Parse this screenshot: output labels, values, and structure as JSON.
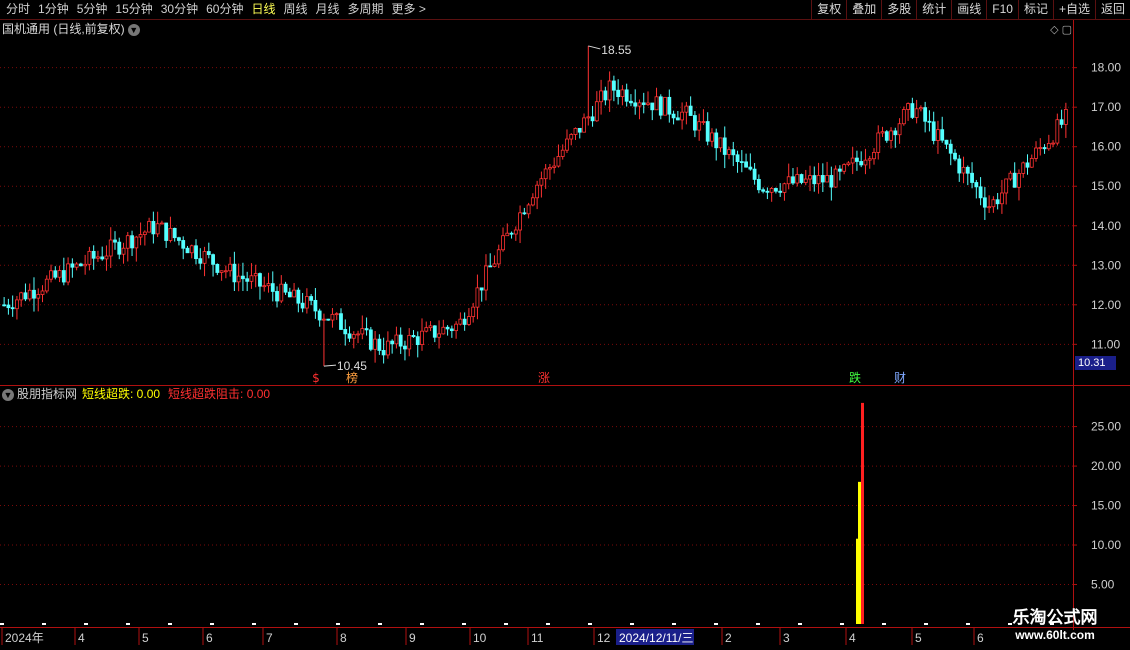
{
  "toolbar": {
    "periods": [
      "分时",
      "1分钟",
      "5分钟",
      "15分钟",
      "30分钟",
      "60分钟",
      "日线",
      "周线",
      "月线",
      "多周期",
      "更多 >"
    ],
    "active_period": "日线",
    "buttons": [
      "复权",
      "叠加",
      "多股",
      "统计",
      "画线",
      "F10",
      "标记",
      "+自选",
      "返回"
    ]
  },
  "stock": {
    "title": "国机通用 (日线,前复权)"
  },
  "price_axis": {
    "ticks": [
      "18.00",
      "17.00",
      "16.00",
      "15.00",
      "14.00",
      "13.00",
      "12.00",
      "11.00"
    ],
    "current": "10.31"
  },
  "annotations": {
    "high": "18.55",
    "low": "10.45"
  },
  "markers": [
    {
      "text": "$",
      "color": "#ff3030"
    },
    {
      "text": "榜",
      "color": "#ffa040"
    },
    {
      "text": "涨",
      "color": "#ff3030"
    },
    {
      "text": "跌",
      "color": "#40ff40"
    },
    {
      "text": "财",
      "color": "#7fa8ff"
    }
  ],
  "indicator": {
    "name": "股朋指标网",
    "line1_label": "短线超跌: 0.00",
    "line2_label": "短线超跌阻击: 0.00",
    "ticks": [
      "25.00",
      "20.00",
      "15.00",
      "10.00",
      "5.00"
    ]
  },
  "date_axis": {
    "labels": [
      "2024年",
      "4",
      "5",
      "6",
      "7",
      "8",
      "9",
      "10",
      "11",
      "12",
      "2",
      "3",
      "4",
      "5",
      "6"
    ],
    "cursor_date": "2024/12/11/三"
  },
  "watermark": {
    "line1": "乐淘公式网",
    "line2": "www.60lt.com"
  },
  "colors": {
    "up": "#ff3232",
    "down": "#54ffff",
    "grid": "#7a0a0a",
    "highlight": "#1a1f8a",
    "yellow": "#ffff00"
  },
  "chart_data": {
    "type": "candlestick",
    "ylim": [
      10.3,
      18.7
    ],
    "x": [
      "2024-03",
      "2024-04",
      "2024-05",
      "2024-06",
      "2024-07",
      "2024-08",
      "2024-09",
      "2024-10",
      "2024-11",
      "2024-12",
      "2025-01",
      "2025-02",
      "2025-03",
      "2025-04",
      "2025-05"
    ],
    "close": [
      12.0,
      13.0,
      14.0,
      12.8,
      12.0,
      10.9,
      11.5,
      15.0,
      17.5,
      16.8,
      15.0,
      15.2,
      17.0,
      14.5,
      16.7
    ],
    "high": 18.55,
    "low": 10.45,
    "indicator_series": [
      {
        "name": "短线超跌",
        "color": "#ffff00",
        "values": [
          0,
          0,
          0,
          0,
          0,
          0,
          0,
          0,
          0,
          0,
          0,
          0,
          0,
          18,
          0
        ]
      },
      {
        "name": "短线超跌阻击",
        "color": "#ff3030",
        "values": [
          0,
          0,
          0,
          0,
          0,
          0,
          0,
          0,
          0,
          0,
          0,
          0,
          0,
          28,
          0
        ]
      }
    ],
    "indicator_ylim": [
      0,
      29
    ]
  }
}
